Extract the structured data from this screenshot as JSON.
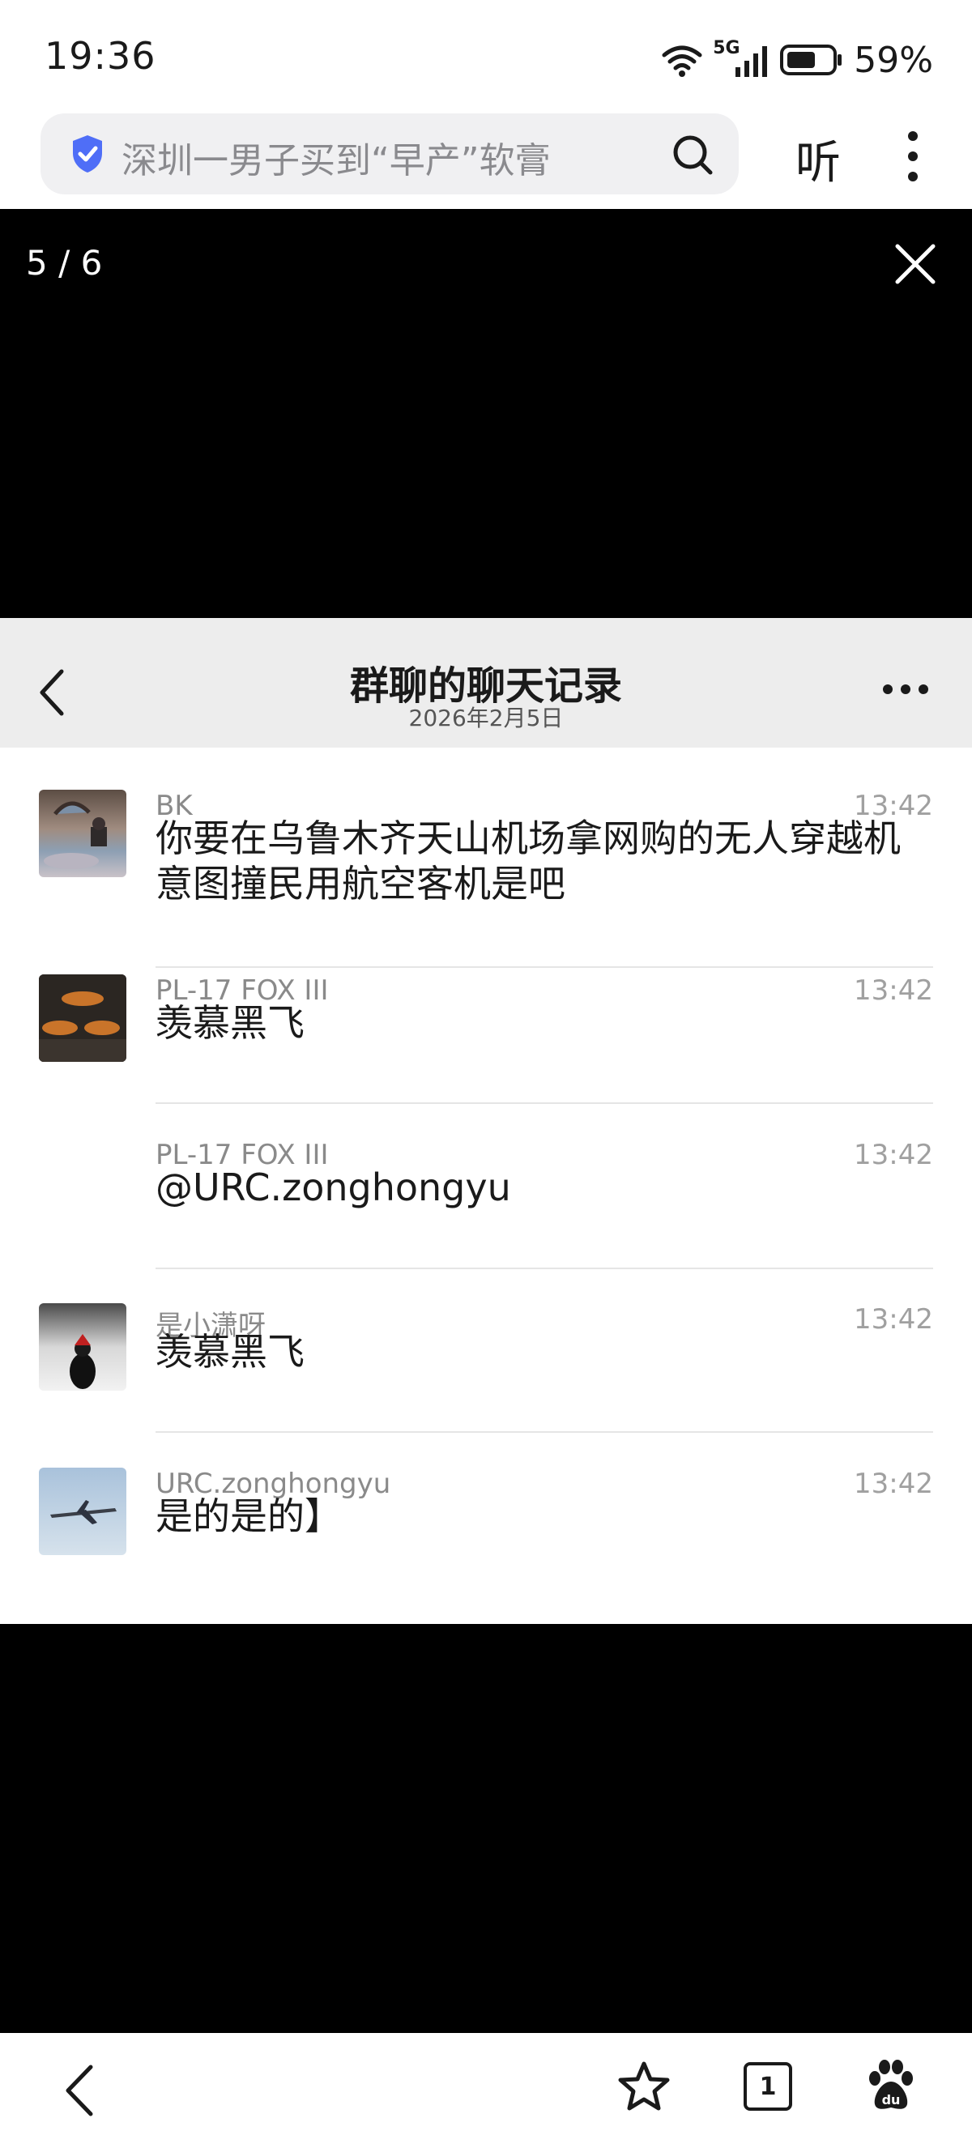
{
  "status_bar": {
    "time": "19:36",
    "network": "5G",
    "battery": "59%"
  },
  "browser": {
    "search_text": "深圳一男子买到“早产”软膏",
    "listen_label": "听"
  },
  "viewer": {
    "counter": "5 / 6"
  },
  "chat": {
    "title": "群聊的聊天记录",
    "date": "2026年2月5日",
    "messages": [
      {
        "sender": "BK",
        "time": "13:42",
        "text": "你要在乌鲁木齐天山机场拿网购的无人穿越机意图撞民用航空客机是吧"
      },
      {
        "sender": "PL-17 FOX III",
        "time": "13:42",
        "text": "羡慕黑飞"
      },
      {
        "sender": "PL-17 FOX III",
        "time": "13:42",
        "text": "@URC.zonghongyu"
      },
      {
        "sender": "是小潇呀",
        "time": "13:42",
        "text": "羡慕黑飞"
      },
      {
        "sender": "URC.zonghongyu",
        "time": "13:42",
        "text": "是的是的】"
      }
    ]
  },
  "bottom_bar": {
    "tab_count": "1"
  },
  "colors": {
    "accent_shield": "#4f6ef7",
    "header_bg": "#ededed",
    "text_primary": "#1a1a1a",
    "text_secondary": "#8a8a8a"
  }
}
